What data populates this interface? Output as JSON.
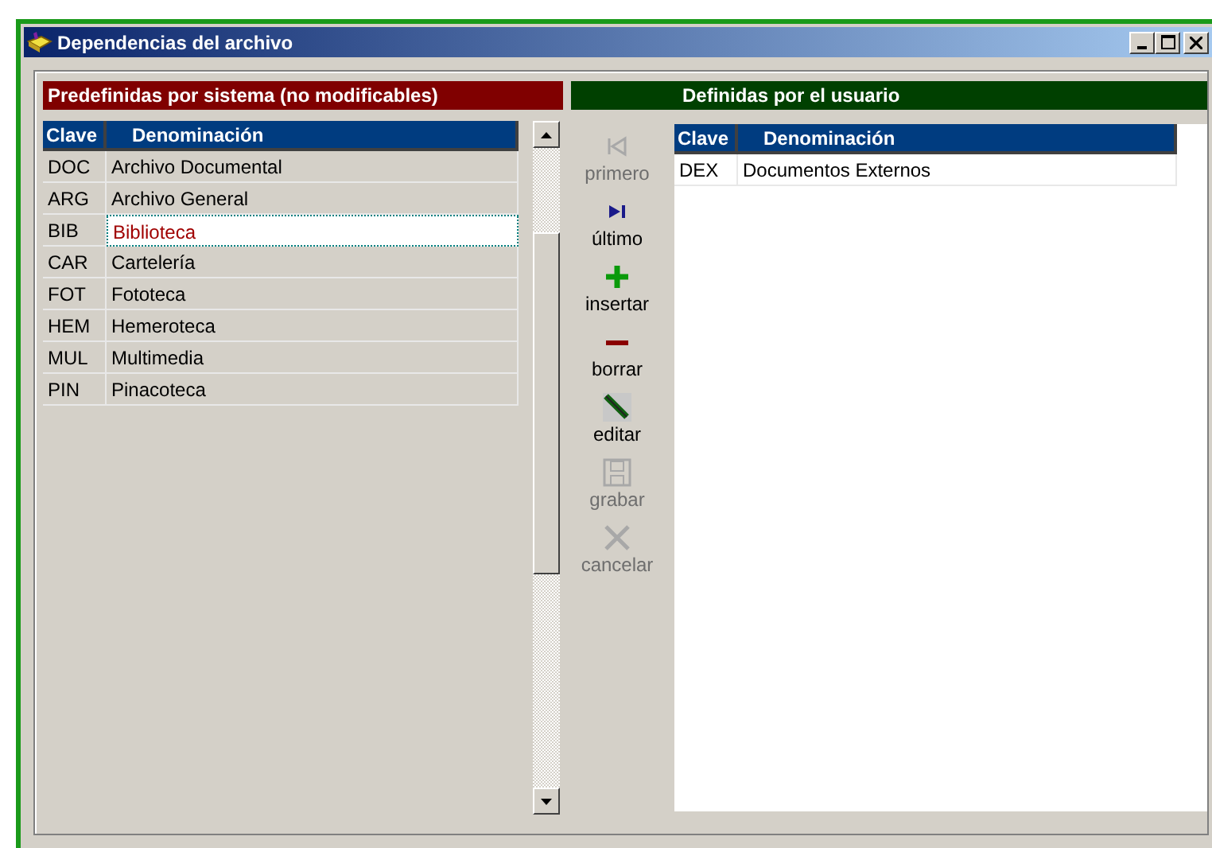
{
  "window": {
    "title": "Dependencias del archivo"
  },
  "predefined": {
    "title": "Predefinidas por sistema (no modificables)",
    "columns": [
      "Clave",
      "Denominación"
    ],
    "rows": [
      {
        "clave": "DOC",
        "denominacion": "Archivo Documental",
        "selected": false
      },
      {
        "clave": "ARG",
        "denominacion": "Archivo General",
        "selected": false
      },
      {
        "clave": "BIB",
        "denominacion": "Biblioteca",
        "selected": true
      },
      {
        "clave": "CAR",
        "denominacion": "Cartelería",
        "selected": false
      },
      {
        "clave": "FOT",
        "denominacion": "Fototeca",
        "selected": false
      },
      {
        "clave": "HEM",
        "denominacion": "Hemeroteca",
        "selected": false
      },
      {
        "clave": "MUL",
        "denominacion": "Multimedia",
        "selected": false
      },
      {
        "clave": "PIN",
        "denominacion": "Pinacoteca",
        "selected": false
      }
    ]
  },
  "toolbar": [
    {
      "kind": "first",
      "label": "primero",
      "disabled": true
    },
    {
      "kind": "last",
      "label": "último",
      "disabled": false
    },
    {
      "kind": "insert",
      "label": "insertar",
      "disabled": false
    },
    {
      "kind": "delete",
      "label": "borrar",
      "disabled": false
    },
    {
      "kind": "edit",
      "label": "editar",
      "disabled": false
    },
    {
      "kind": "save",
      "label": "grabar",
      "disabled": true
    },
    {
      "kind": "cancel",
      "label": "cancelar",
      "disabled": true
    }
  ],
  "user_defined": {
    "title": "Definidas por el usuario",
    "columns": [
      "Clave",
      "Denominación"
    ],
    "rows": [
      {
        "clave": "DEX",
        "denominacion": "Documentos Externos",
        "selected": false
      }
    ]
  }
}
